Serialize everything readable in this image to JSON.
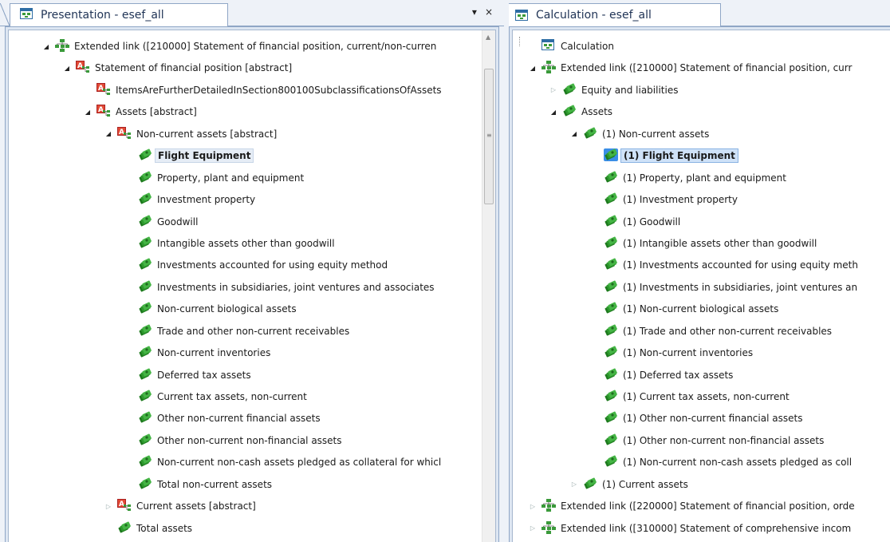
{
  "left": {
    "tab_title": "Presentation - esef_all",
    "dropdown_glyph": "▾",
    "close_glyph": "×",
    "nodes": [
      {
        "label": "Extended link ([210000] Statement of financial position, current/non-curren",
        "depth": 0,
        "exp": "open",
        "icon": "extended-link-icon"
      },
      {
        "label": "Statement of financial position [abstract]",
        "depth": 1,
        "exp": "open",
        "icon": "abstract-icon"
      },
      {
        "label": "ItemsAreFurtherDetailedInSection800100SubclassificationsOfAssets",
        "depth": 2,
        "exp": "none",
        "icon": "abstract-icon"
      },
      {
        "label": "Assets [abstract]",
        "depth": 2,
        "exp": "open",
        "icon": "abstract-icon"
      },
      {
        "label": "Non-current assets [abstract]",
        "depth": 3,
        "exp": "open",
        "icon": "abstract-icon"
      },
      {
        "label": "Flight Equipment",
        "depth": 4,
        "exp": "none",
        "icon": "money-icon",
        "selected": "grey"
      },
      {
        "label": "Property, plant and equipment",
        "depth": 4,
        "exp": "none",
        "icon": "money-icon"
      },
      {
        "label": "Investment property",
        "depth": 4,
        "exp": "none",
        "icon": "money-icon"
      },
      {
        "label": "Goodwill",
        "depth": 4,
        "exp": "none",
        "icon": "money-icon"
      },
      {
        "label": "Intangible assets other than goodwill",
        "depth": 4,
        "exp": "none",
        "icon": "money-icon"
      },
      {
        "label": "Investments accounted for using equity method",
        "depth": 4,
        "exp": "none",
        "icon": "money-icon"
      },
      {
        "label": "Investments in subsidiaries, joint ventures and associates",
        "depth": 4,
        "exp": "none",
        "icon": "money-icon"
      },
      {
        "label": "Non-current biological assets",
        "depth": 4,
        "exp": "none",
        "icon": "money-icon"
      },
      {
        "label": "Trade and other non-current receivables",
        "depth": 4,
        "exp": "none",
        "icon": "money-icon"
      },
      {
        "label": "Non-current inventories",
        "depth": 4,
        "exp": "none",
        "icon": "money-icon"
      },
      {
        "label": "Deferred tax assets",
        "depth": 4,
        "exp": "none",
        "icon": "money-icon"
      },
      {
        "label": "Current tax assets, non-current",
        "depth": 4,
        "exp": "none",
        "icon": "money-icon"
      },
      {
        "label": "Other non-current financial assets",
        "depth": 4,
        "exp": "none",
        "icon": "money-icon"
      },
      {
        "label": "Other non-current non-financial assets",
        "depth": 4,
        "exp": "none",
        "icon": "money-icon"
      },
      {
        "label": "Non-current non-cash assets pledged as collateral for whicl",
        "depth": 4,
        "exp": "none",
        "icon": "money-icon"
      },
      {
        "label": "Total non-current assets",
        "depth": 4,
        "exp": "none",
        "icon": "money-icon"
      },
      {
        "label": "Current assets [abstract]",
        "depth": 3,
        "exp": "closed",
        "icon": "abstract-icon"
      },
      {
        "label": "Total assets",
        "depth": 3,
        "exp": "none",
        "icon": "money-icon"
      }
    ]
  },
  "right": {
    "tab_title": "Calculation - esef_all",
    "nodes": [
      {
        "label": "Calculation",
        "depth": 0,
        "exp": "none",
        "icon": "calculation-icon"
      },
      {
        "label": "Extended link ([210000] Statement of financial position, curr",
        "depth": 0,
        "exp": "open",
        "icon": "extended-link-icon"
      },
      {
        "label": "Equity and liabilities",
        "depth": 1,
        "exp": "closed",
        "icon": "money-icon"
      },
      {
        "label": "Assets",
        "depth": 1,
        "exp": "open",
        "icon": "money-icon"
      },
      {
        "label": "(1) Non-current assets",
        "depth": 2,
        "exp": "open",
        "icon": "money-icon"
      },
      {
        "label": "(1) Flight Equipment",
        "depth": 3,
        "exp": "none",
        "icon": "money-icon",
        "selected": "blue"
      },
      {
        "label": "(1) Property, plant and equipment",
        "depth": 3,
        "exp": "none",
        "icon": "money-icon"
      },
      {
        "label": "(1) Investment property",
        "depth": 3,
        "exp": "none",
        "icon": "money-icon"
      },
      {
        "label": "(1) Goodwill",
        "depth": 3,
        "exp": "none",
        "icon": "money-icon"
      },
      {
        "label": "(1) Intangible assets other than goodwill",
        "depth": 3,
        "exp": "none",
        "icon": "money-icon"
      },
      {
        "label": "(1) Investments accounted for using equity meth",
        "depth": 3,
        "exp": "none",
        "icon": "money-icon"
      },
      {
        "label": "(1) Investments in subsidiaries, joint ventures an",
        "depth": 3,
        "exp": "none",
        "icon": "money-icon"
      },
      {
        "label": "(1) Non-current biological assets",
        "depth": 3,
        "exp": "none",
        "icon": "money-icon"
      },
      {
        "label": "(1) Trade and other non-current receivables",
        "depth": 3,
        "exp": "none",
        "icon": "money-icon"
      },
      {
        "label": "(1) Non-current inventories",
        "depth": 3,
        "exp": "none",
        "icon": "money-icon"
      },
      {
        "label": "(1) Deferred tax assets",
        "depth": 3,
        "exp": "none",
        "icon": "money-icon"
      },
      {
        "label": "(1) Current tax assets, non-current",
        "depth": 3,
        "exp": "none",
        "icon": "money-icon"
      },
      {
        "label": "(1) Other non-current financial assets",
        "depth": 3,
        "exp": "none",
        "icon": "money-icon"
      },
      {
        "label": "(1) Other non-current non-financial assets",
        "depth": 3,
        "exp": "none",
        "icon": "money-icon"
      },
      {
        "label": "(1) Non-current non-cash assets pledged as coll",
        "depth": 3,
        "exp": "none",
        "icon": "money-icon"
      },
      {
        "label": "(1) Current assets",
        "depth": 2,
        "exp": "closed",
        "icon": "money-icon"
      },
      {
        "label": "Extended link ([220000] Statement of financial position, orde",
        "depth": 0,
        "exp": "closed",
        "icon": "extended-link-icon"
      },
      {
        "label": "Extended link ([310000] Statement of comprehensive incom",
        "depth": 0,
        "exp": "closed",
        "icon": "extended-link-icon"
      }
    ]
  },
  "colors": {
    "money_green": "#2e8b2e",
    "abstract_red": "#d83a2a",
    "link_green": "#3a8f3a",
    "selection_blue": "#cfe2f8"
  }
}
